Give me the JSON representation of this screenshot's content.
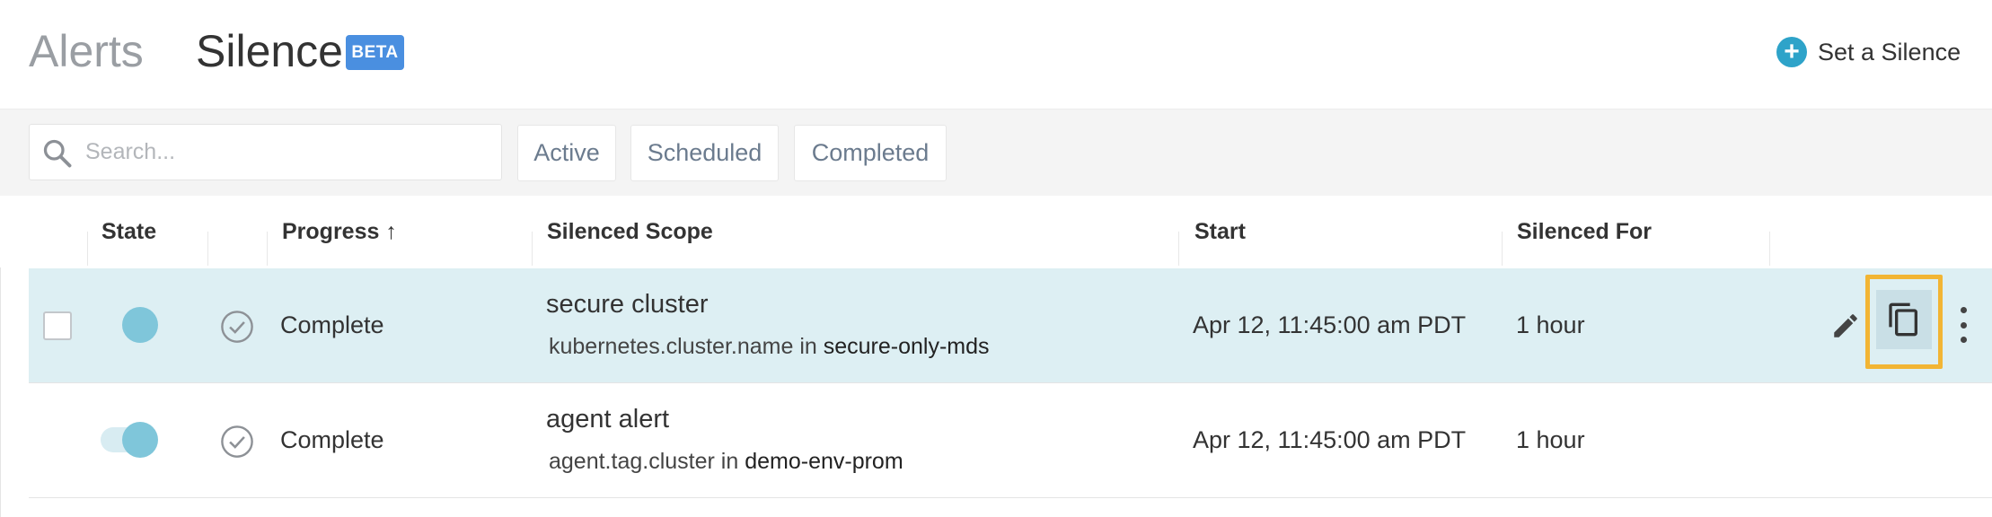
{
  "header": {
    "tab_alerts": "Alerts",
    "tab_silence": "Silence",
    "beta_badge": "BETA",
    "set_silence_label": "Set a Silence",
    "plus_icon": "+"
  },
  "toolbar": {
    "search_placeholder": "Search...",
    "filters": [
      "Active",
      "Scheduled",
      "Completed"
    ]
  },
  "table": {
    "columns": {
      "state": "State",
      "progress": "Progress ↑",
      "scope": "Silenced Scope",
      "start": "Start",
      "silenced_for": "Silenced For"
    },
    "rows": [
      {
        "selected": true,
        "progress": "Complete",
        "scope_title": "secure cluster",
        "scope_key": "kubernetes.cluster.name in",
        "scope_value": "secure-only-mds",
        "start": "Apr 12, 11:45:00 am PDT",
        "silenced_for": "1 hour"
      },
      {
        "selected": false,
        "progress": "Complete",
        "scope_title": "agent alert",
        "scope_key": "agent.tag.cluster in",
        "scope_value": "demo-env-prom",
        "start": "Apr 12, 11:45:00 am PDT",
        "silenced_for": "1 hour"
      }
    ]
  },
  "colors": {
    "accent": "#2ea3c9",
    "beta": "#4a8fe0",
    "row_highlight": "#ddeff3",
    "highlight_border": "#f2b534",
    "toggle_knob": "#7fc6da"
  },
  "icons": [
    "plus-circle-icon",
    "search-icon",
    "check-circle-icon",
    "edit-icon",
    "copy-icon",
    "more-vertical-icon"
  ]
}
